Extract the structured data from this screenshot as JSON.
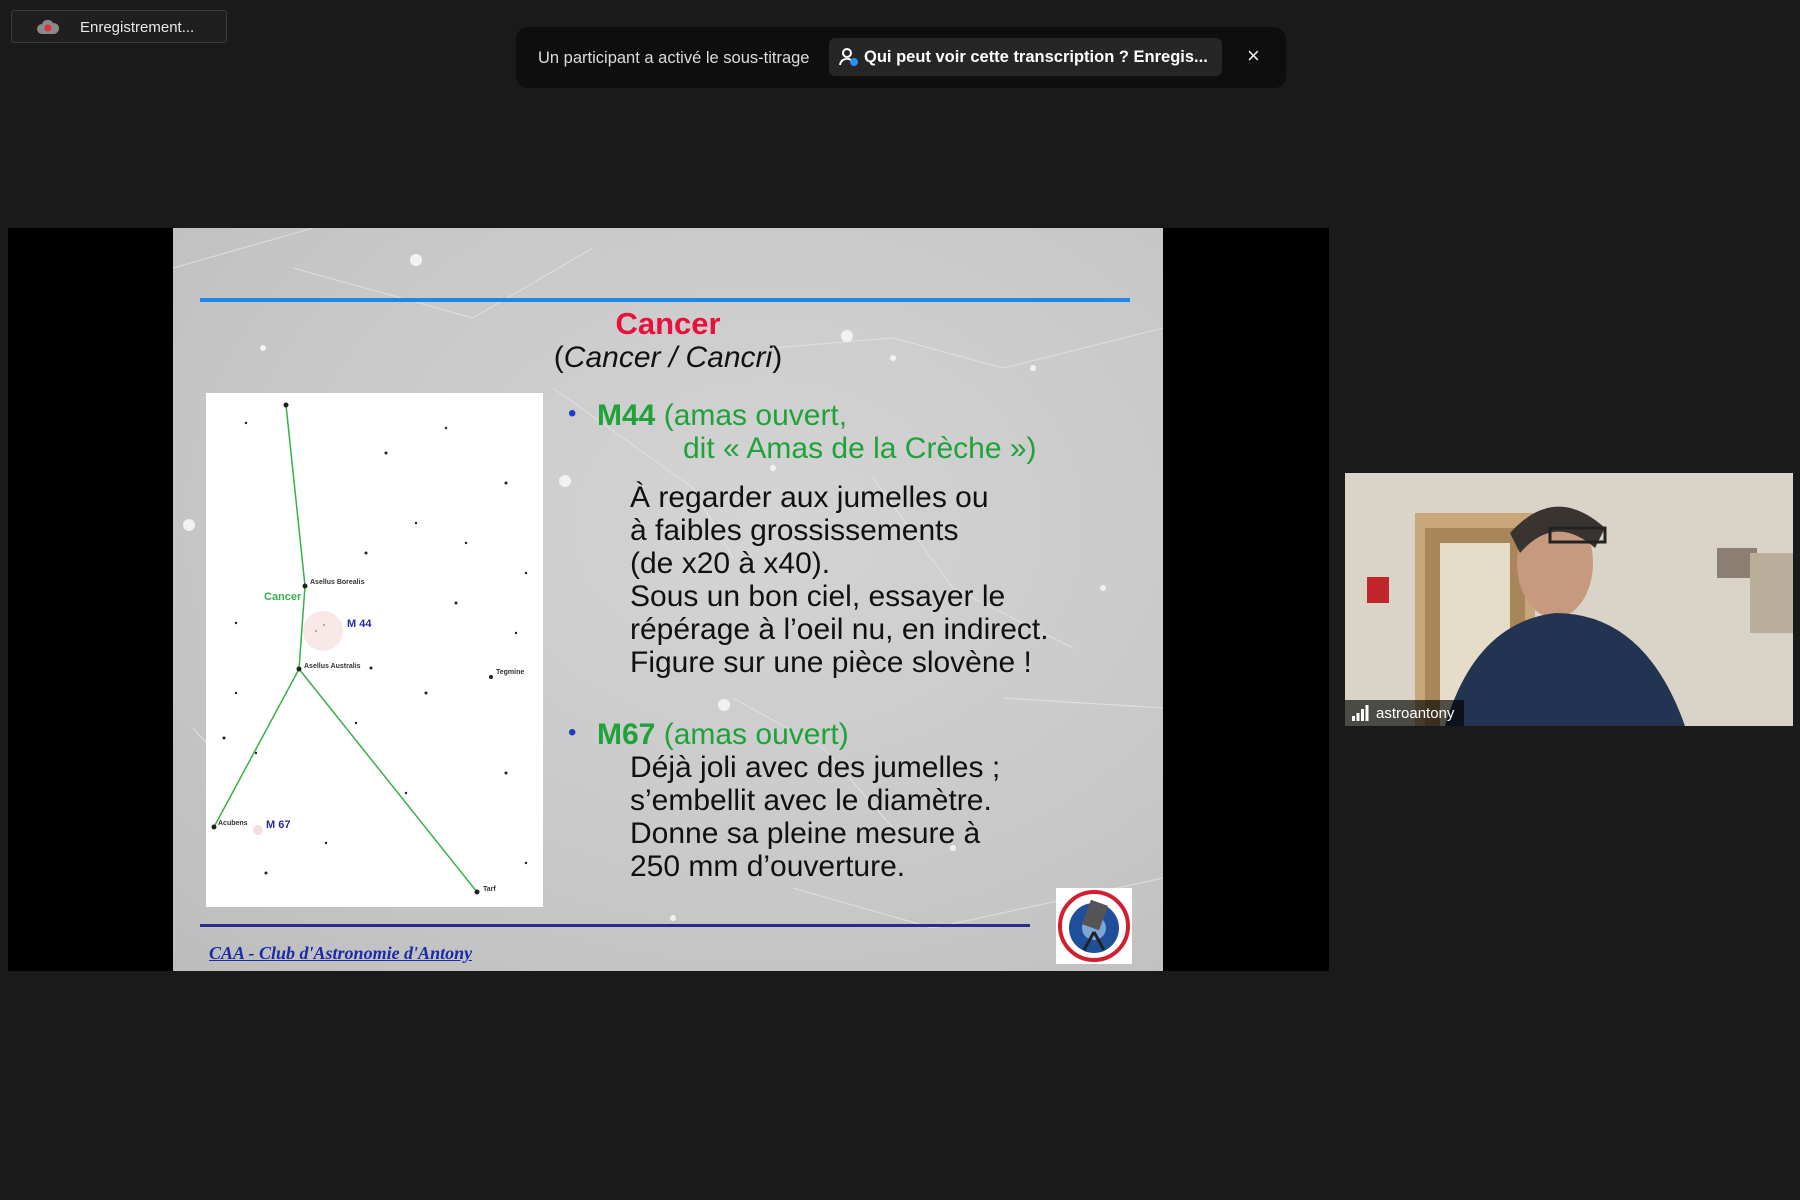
{
  "recording": {
    "label": "Enregistrement...",
    "icon": "cloud-recording-icon"
  },
  "caption_notice": {
    "message": "Un participant a activé le sous-titrage",
    "visibility_button": "Qui peut voir cette transcription ? Enregis...",
    "close": "×"
  },
  "slide": {
    "title": "Cancer",
    "subtitle_open": "(",
    "subtitle_italic": "Cancer / Cancri",
    "subtitle_close": ")",
    "m44": {
      "name": "M44",
      "type": "(amas ouvert,",
      "nickname": "dit « Amas de la Crèche »)",
      "lines": [
        "À regarder aux jumelles ou",
        "à faibles grossissements",
        "(de x20 à x40).",
        "Sous un bon ciel, essayer le",
        "répérage à l’oeil nu, en indirect.",
        "Figure sur une pièce slovène !"
      ]
    },
    "m67": {
      "name": "M67",
      "type": "(amas ouvert)",
      "lines": [
        "Déjà joli avec des jumelles ;",
        "s’embellit avec le diamètre.",
        "Donne sa pleine mesure à",
        "250 mm d’ouverture."
      ]
    },
    "bullet": "•",
    "chart_labels": {
      "constellation": "Cancer",
      "asellus_borealis": "Asellus Borealis",
      "asellus_australis": "Asellus Australis",
      "m44": "M 44",
      "tegmine": "Tegmine",
      "acubens": "Acubens",
      "m67": "M 67",
      "tarf": "Tarf"
    },
    "footer": "CAA - Club d'Astronomie d'Antony"
  },
  "participant": {
    "name": "astroantony"
  },
  "colors": {
    "accent_red": "#e8103c",
    "accent_green": "#1fa23a",
    "bullet_blue": "#1a3cc8",
    "line_blue": "#1e88e5"
  }
}
